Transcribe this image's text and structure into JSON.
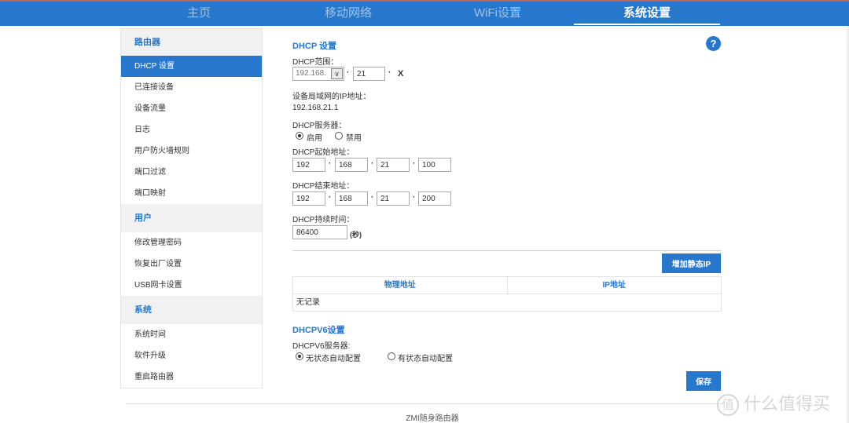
{
  "topnav": {
    "items": [
      {
        "label": "主页",
        "active": false
      },
      {
        "label": "移动网络",
        "active": false
      },
      {
        "label": "WiFi设置",
        "active": false
      },
      {
        "label": "系统设置",
        "active": true
      }
    ]
  },
  "sidebar": {
    "groups": [
      {
        "title": "路由器",
        "items": [
          "DHCP 设置",
          "已连接设备",
          "设备流量",
          "日志",
          "用户防火墙规则",
          "端口过滤",
          "端口映射"
        ]
      },
      {
        "title": "用户",
        "items": [
          "修改管理密码",
          "恢复出厂设置",
          "USB网卡设置"
        ]
      },
      {
        "title": "系统",
        "items": [
          "系统时间",
          "软件升级",
          "重启路由器"
        ]
      }
    ],
    "active_item": "DHCP 设置"
  },
  "dhcp": {
    "title": "DHCP 设置",
    "range_label": "DHCP范围：",
    "range_prefix_selected": "192.168.",
    "range_third_octet": "21",
    "range_suffix": "X",
    "dot": "·",
    "lan_ip_label": "设备局域网的IP地址：",
    "lan_ip_value": "192.168.21.1",
    "server_label": "DHCP服务器：",
    "server_options": [
      {
        "label": "启用",
        "checked": true
      },
      {
        "label": "禁用",
        "checked": false
      }
    ],
    "start_label": "DHCP起始地址：",
    "start_octets": [
      "192",
      "168",
      "21",
      "100"
    ],
    "end_label": "DHCP结束地址：",
    "end_octets": [
      "192",
      "168",
      "21",
      "200"
    ],
    "lease_label": "DHCP持续时间：",
    "lease_value": "86400",
    "lease_unit": "(秒)",
    "help_icon": "?"
  },
  "static_ip": {
    "add_button": "增加静态IP",
    "columns": [
      "物理地址",
      "IP地址"
    ],
    "empty_text": "无记录"
  },
  "dhcpv6": {
    "title": "DHCPV6设置",
    "server_label": "DHCPV6服务器:",
    "options": [
      {
        "label": "无状态自动配置",
        "checked": true
      },
      {
        "label": "有状态自动配置",
        "checked": false
      }
    ]
  },
  "save_button": "保存",
  "footer": "ZMI随身路由器",
  "watermark": {
    "circle": "值",
    "text": "什么值得买"
  }
}
